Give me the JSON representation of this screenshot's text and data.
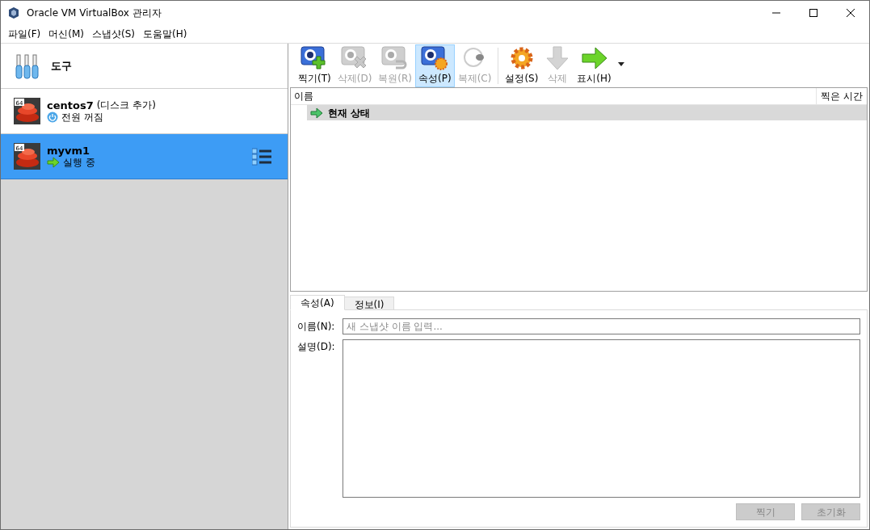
{
  "window": {
    "title": "Oracle VM VirtualBox 관리자"
  },
  "menu": [
    "파일(F)",
    "머신(M)",
    "스냅샷(S)",
    "도움말(H)"
  ],
  "sidebar": {
    "tools_label": "도구",
    "vms": [
      {
        "kind": "off",
        "badge": "64",
        "name": "centos7",
        "note": "(디스크 추가)",
        "status": "전원 꺼짐",
        "selected": false
      },
      {
        "kind": "running",
        "badge": "64",
        "name": "myvm1",
        "status": "실행 중",
        "selected": true
      }
    ]
  },
  "toolbar": [
    {
      "kind": "take",
      "label": "찍기(T)",
      "disabled": false,
      "selected": false
    },
    {
      "kind": "delete",
      "label": "삭제(D)",
      "disabled": true,
      "selected": false
    },
    {
      "kind": "restore",
      "label": "복원(R)",
      "disabled": true,
      "selected": false
    },
    {
      "kind": "properties",
      "label": "속성(P)",
      "disabled": false,
      "selected": true
    },
    {
      "kind": "clone",
      "label": "복제(C)",
      "disabled": true,
      "selected": false
    },
    {
      "kind": "settings",
      "label": "설정(S)",
      "disabled": false,
      "selected": false
    },
    {
      "kind": "discard",
      "label": "삭제",
      "disabled": true,
      "selected": false
    },
    {
      "kind": "show",
      "label": "표시(H)",
      "disabled": false,
      "selected": false
    }
  ],
  "snapshots": {
    "columns": [
      "이름",
      "찍은 시간"
    ],
    "rows": [
      {
        "name": "현재 상태",
        "selected": true
      }
    ]
  },
  "details": {
    "tabs": [
      {
        "label": "속성(A)",
        "selected": true
      },
      {
        "label": "정보(I)",
        "selected": false
      }
    ],
    "name_label": "이름(N):",
    "name_placeholder": "새 스냅샷 이름 입력...",
    "description_label": "설명(D):",
    "buttons": [
      {
        "label": "찍기",
        "disabled": true
      },
      {
        "label": "초기화",
        "disabled": true
      }
    ]
  }
}
